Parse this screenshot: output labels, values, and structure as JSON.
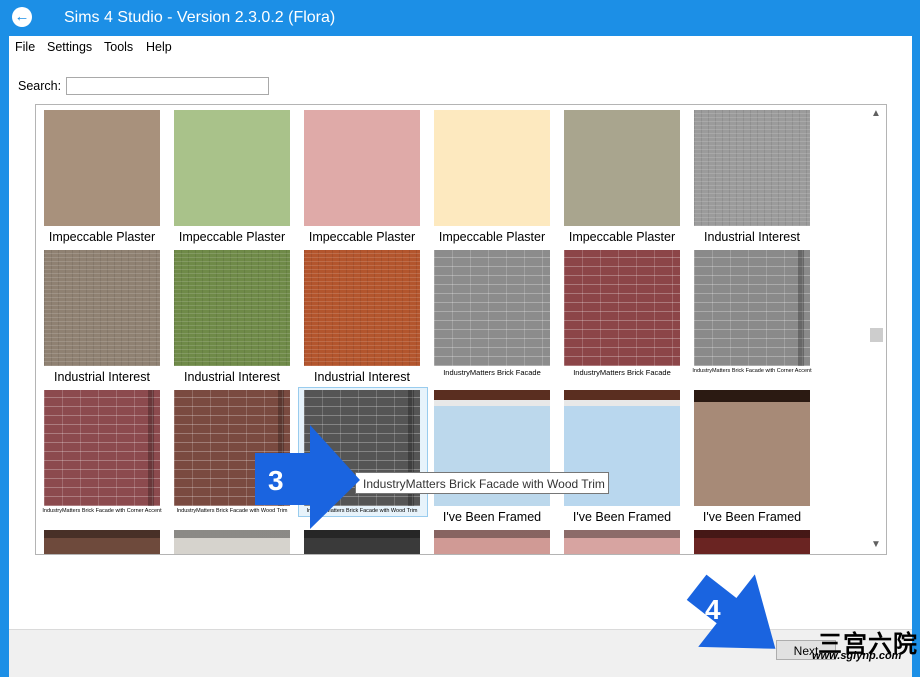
{
  "window": {
    "title": "Sims 4 Studio - Version 2.3.0.2  (Flora)",
    "accent_color": "#1c8fe6",
    "back_icon": "arrow-left-circle-icon"
  },
  "menu": [
    "File",
    "Settings",
    "Tools",
    "Help"
  ],
  "search": {
    "label": "Search:",
    "value": ""
  },
  "rows": [
    [
      {
        "label": "Impeccable Plaster",
        "color": "#a8917c",
        "pattern": "plaster",
        "label_size": "normal"
      },
      {
        "label": "Impeccable Plaster",
        "color": "#a9c28a",
        "pattern": "plaster",
        "label_size": "normal"
      },
      {
        "label": "Impeccable Plaster",
        "color": "#dfaaa8",
        "pattern": "plaster",
        "label_size": "normal"
      },
      {
        "label": "Impeccable Plaster",
        "color": "#fde9bf",
        "pattern": "plaster",
        "label_size": "normal"
      },
      {
        "label": "Impeccable Plaster",
        "color": "#a9a58e",
        "pattern": "plaster",
        "label_size": "normal"
      },
      {
        "label": "Industrial Interest",
        "color": "#9b9b9b",
        "pattern": "fine",
        "label_size": "normal"
      }
    ],
    [
      {
        "label": "Industrial Interest",
        "color": "#8f8172",
        "pattern": "fine",
        "label_size": "normal"
      },
      {
        "label": "Industrial Interest",
        "color": "#6f8a48",
        "pattern": "fine",
        "label_size": "normal"
      },
      {
        "label": "Industrial Interest",
        "color": "#b3552d",
        "pattern": "fine",
        "label_size": "normal"
      },
      {
        "label": "IndustryMatters Brick Facade",
        "color": "#8c8c8c",
        "pattern": "brick",
        "label_size": "small"
      },
      {
        "label": "IndustryMatters Brick Facade",
        "color": "#8c4548",
        "pattern": "brick",
        "label_size": "small"
      },
      {
        "label": "IndustryMatters Brick Facade with Corner Accent",
        "color": "#8a8a8a",
        "pattern": "brick-trim",
        "label_size": "tiny"
      }
    ],
    [
      {
        "label": "IndustryMatters Brick Facade with Corner Accent",
        "color": "#8c4a4e",
        "pattern": "brick-trim",
        "label_size": "tiny"
      },
      {
        "label": "IndustryMatters Brick Facade with Wood Trim",
        "color": "#7a4a40",
        "pattern": "brick-trim",
        "label_size": "tiny"
      },
      {
        "label": "IndustryMatters Brick Facade with Wood Trim",
        "color": "#555555",
        "pattern": "brick-trim",
        "label_size": "tiny"
      },
      {
        "label": "",
        "color": "#bcd8ec",
        "pattern": "framed-light",
        "label_size": "normal"
      },
      {
        "label": "I've Been Framed",
        "color": "#b9d7ee",
        "pattern": "framed-white",
        "label_size": "normal"
      },
      {
        "label": "I've Been Framed",
        "color": "#a78a77",
        "pattern": "framed-dark",
        "label_size": "normal"
      }
    ],
    [
      {
        "label": "",
        "color": "#6e4a3c",
        "pattern": "partial",
        "label_size": "normal"
      },
      {
        "label": "",
        "color": "#d6d3cd",
        "pattern": "partial",
        "label_size": "normal"
      },
      {
        "label": "",
        "color": "#3a3a3a",
        "pattern": "partial",
        "label_size": "normal"
      },
      {
        "label": "",
        "color": "#d09a95",
        "pattern": "partial",
        "label_size": "normal"
      },
      {
        "label": "",
        "color": "#d7a4a1",
        "pattern": "partial",
        "label_size": "normal"
      },
      {
        "label": "",
        "color": "#6a2422",
        "pattern": "partial",
        "label_size": "normal"
      }
    ]
  ],
  "overlay_labels": {
    "r2c3": "I've Been Framed"
  },
  "tooltip": "IndustryMatters Brick Facade with Wood Trim",
  "annotations": {
    "step3": "3",
    "step4": "4",
    "arrow_color": "#1a64e0"
  },
  "footer": {
    "next_label": "Next"
  },
  "watermark": {
    "url": "www.sglynp.com",
    "text": "三宫六院"
  }
}
